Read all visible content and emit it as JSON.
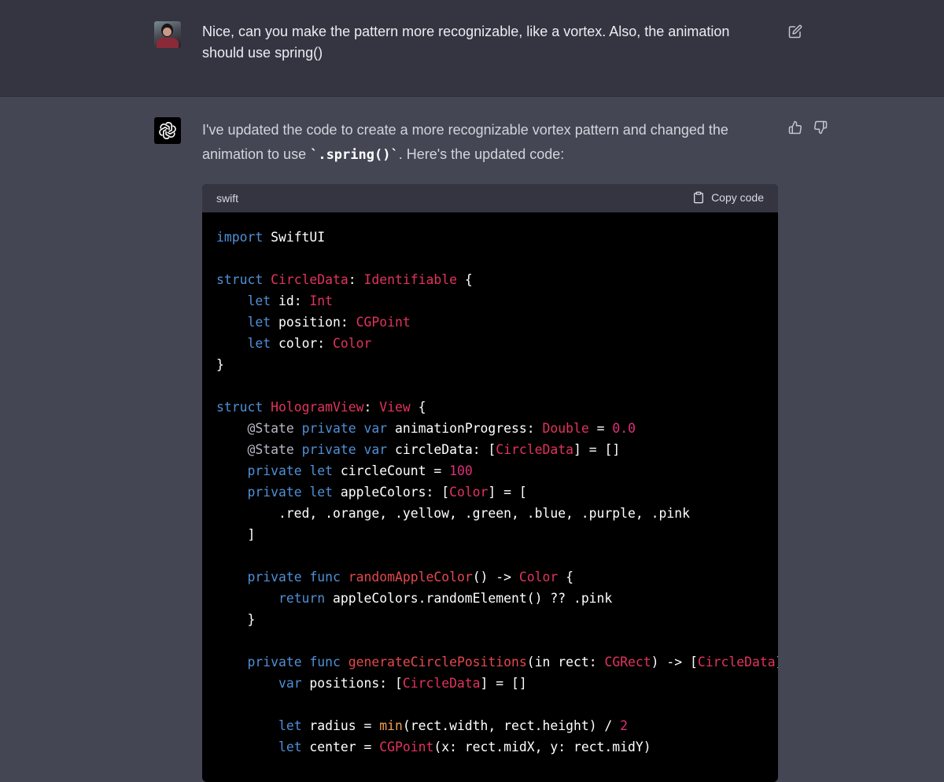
{
  "user_message": {
    "text": "Nice, can you make the pattern more recognizable, like a vortex. Also, the animation should use spring()"
  },
  "assistant_message": {
    "text_before_code": "I've updated the code to create a more recognizable vortex pattern and changed the animation to use ",
    "inline_code": "`.spring()`",
    "text_after_code": ". Here's the updated code:"
  },
  "code_block": {
    "language": "swift",
    "copy_label": "Copy code",
    "lines": [
      [
        [
          "kw",
          "import"
        ],
        [
          "pl",
          " SwiftUI"
        ]
      ],
      [],
      [
        [
          "kw",
          "struct"
        ],
        [
          "pl",
          " "
        ],
        [
          "ty",
          "CircleData"
        ],
        [
          "pl",
          ": "
        ],
        [
          "ty",
          "Identifiable"
        ],
        [
          "pl",
          " {"
        ]
      ],
      [
        [
          "pl",
          "    "
        ],
        [
          "kw",
          "let"
        ],
        [
          "pl",
          " id: "
        ],
        [
          "ty",
          "Int"
        ]
      ],
      [
        [
          "pl",
          "    "
        ],
        [
          "kw",
          "let"
        ],
        [
          "pl",
          " position: "
        ],
        [
          "ty",
          "CGPoint"
        ]
      ],
      [
        [
          "pl",
          "    "
        ],
        [
          "kw",
          "let"
        ],
        [
          "pl",
          " color: "
        ],
        [
          "ty",
          "Color"
        ]
      ],
      [
        [
          "pl",
          "}"
        ]
      ],
      [],
      [
        [
          "kw",
          "struct"
        ],
        [
          "pl",
          " "
        ],
        [
          "ty",
          "HologramView"
        ],
        [
          "pl",
          ": "
        ],
        [
          "ty",
          "View"
        ],
        [
          "pl",
          " {"
        ]
      ],
      [
        [
          "pl",
          "    "
        ],
        [
          "at",
          "@State"
        ],
        [
          "pl",
          " "
        ],
        [
          "kw",
          "private"
        ],
        [
          "pl",
          " "
        ],
        [
          "kw",
          "var"
        ],
        [
          "pl",
          " animationProgress: "
        ],
        [
          "ty",
          "Double"
        ],
        [
          "pl",
          " = "
        ],
        [
          "nm",
          "0.0"
        ]
      ],
      [
        [
          "pl",
          "    "
        ],
        [
          "at",
          "@State"
        ],
        [
          "pl",
          " "
        ],
        [
          "kw",
          "private"
        ],
        [
          "pl",
          " "
        ],
        [
          "kw",
          "var"
        ],
        [
          "pl",
          " circleData: ["
        ],
        [
          "ty",
          "CircleData"
        ],
        [
          "pl",
          "] = []"
        ]
      ],
      [
        [
          "pl",
          "    "
        ],
        [
          "kw",
          "private"
        ],
        [
          "pl",
          " "
        ],
        [
          "kw",
          "let"
        ],
        [
          "pl",
          " circleCount = "
        ],
        [
          "nm",
          "100"
        ]
      ],
      [
        [
          "pl",
          "    "
        ],
        [
          "kw",
          "private"
        ],
        [
          "pl",
          " "
        ],
        [
          "kw",
          "let"
        ],
        [
          "pl",
          " appleColors: ["
        ],
        [
          "ty",
          "Color"
        ],
        [
          "pl",
          "] = ["
        ]
      ],
      [
        [
          "pl",
          "        .red, .orange, .yellow, .green, .blue, .purple, .pink"
        ]
      ],
      [
        [
          "pl",
          "    ]"
        ]
      ],
      [],
      [
        [
          "pl",
          "    "
        ],
        [
          "kw",
          "private"
        ],
        [
          "pl",
          " "
        ],
        [
          "kw",
          "func"
        ],
        [
          "pl",
          " "
        ],
        [
          "fn",
          "randomAppleColor"
        ],
        [
          "pl",
          "() -> "
        ],
        [
          "ty",
          "Color"
        ],
        [
          "pl",
          " {"
        ]
      ],
      [
        [
          "pl",
          "        "
        ],
        [
          "kw",
          "return"
        ],
        [
          "pl",
          " appleColors.randomElement() ?? .pink"
        ]
      ],
      [
        [
          "pl",
          "    }"
        ]
      ],
      [],
      [
        [
          "pl",
          "    "
        ],
        [
          "kw",
          "private"
        ],
        [
          "pl",
          " "
        ],
        [
          "kw",
          "func"
        ],
        [
          "pl",
          " "
        ],
        [
          "fn",
          "generateCirclePositions"
        ],
        [
          "pl",
          "(in rect: "
        ],
        [
          "ty",
          "CGRect"
        ],
        [
          "pl",
          ") -> ["
        ],
        [
          "ty",
          "CircleData"
        ],
        [
          "pl",
          "] {"
        ]
      ],
      [
        [
          "pl",
          "        "
        ],
        [
          "kw",
          "var"
        ],
        [
          "pl",
          " positions: ["
        ],
        [
          "ty",
          "CircleData"
        ],
        [
          "pl",
          "] = []"
        ]
      ],
      [],
      [
        [
          "pl",
          "        "
        ],
        [
          "kw",
          "let"
        ],
        [
          "pl",
          " radius = "
        ],
        [
          "bi",
          "min"
        ],
        [
          "pl",
          "(rect.width, rect.height) / "
        ],
        [
          "nm",
          "2"
        ]
      ],
      [
        [
          "pl",
          "        "
        ],
        [
          "kw",
          "let"
        ],
        [
          "pl",
          " center = "
        ],
        [
          "ty",
          "CGPoint"
        ],
        [
          "pl",
          "(x: rect.midX, y: rect.midY)"
        ]
      ]
    ]
  },
  "icons": {
    "edit": "edit-icon",
    "thumbs_up": "thumbs-up-icon",
    "thumbs_down": "thumbs-down-icon",
    "clipboard": "clipboard-icon",
    "openai_logo": "openai-logo-icon"
  },
  "colors": {
    "user_bg": "#343541",
    "assistant_bg": "#444654",
    "code_bg": "#000000",
    "keyword": "#4f8fd6",
    "type": "#e2335d",
    "number": "#df3079"
  }
}
